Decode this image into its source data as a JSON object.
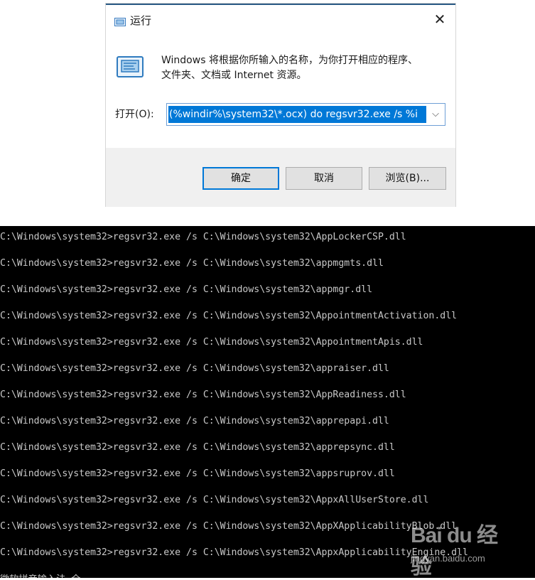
{
  "run_dialog": {
    "title": "运行",
    "close_symbol": "✕",
    "description_line1": "Windows 将根据你所输入的名称，为你打开相应的程序、",
    "description_line2": "文件夹、文档或 Internet 资源。",
    "open_label": "打开(O):",
    "command_value": "(%windir%\\system32\\*.ocx) do regsvr32.exe /s %i",
    "dropdown_symbol": "⌵",
    "buttons": {
      "ok": "确定",
      "cancel": "取消",
      "browse": "浏览(B)..."
    },
    "icons": [
      "run-small-icon",
      "run-large-icon",
      "close-icon",
      "chevron-down-icon"
    ]
  },
  "console": {
    "lines": [
      "C:\\Windows\\system32>regsvr32.exe /s C:\\Windows\\system32\\AppLockerCSP.dll",
      "C:\\Windows\\system32>regsvr32.exe /s C:\\Windows\\system32\\appmgmts.dll",
      "C:\\Windows\\system32>regsvr32.exe /s C:\\Windows\\system32\\appmgr.dll",
      "C:\\Windows\\system32>regsvr32.exe /s C:\\Windows\\system32\\AppointmentActivation.dll",
      "C:\\Windows\\system32>regsvr32.exe /s C:\\Windows\\system32\\AppointmentApis.dll",
      "C:\\Windows\\system32>regsvr32.exe /s C:\\Windows\\system32\\appraiser.dll",
      "C:\\Windows\\system32>regsvr32.exe /s C:\\Windows\\system32\\AppReadiness.dll",
      "C:\\Windows\\system32>regsvr32.exe /s C:\\Windows\\system32\\apprepapi.dll",
      "C:\\Windows\\system32>regsvr32.exe /s C:\\Windows\\system32\\apprepsync.dll",
      "C:\\Windows\\system32>regsvr32.exe /s C:\\Windows\\system32\\appsruprov.dll",
      "C:\\Windows\\system32>regsvr32.exe /s C:\\Windows\\system32\\AppxAllUserStore.dll",
      "C:\\Windows\\system32>regsvr32.exe /s C:\\Windows\\system32\\AppXApplicabilityBlob.dll",
      "C:\\Windows\\system32>regsvr32.exe /s C:\\Windows\\system32\\AppxApplicabilityEngine.dll",
      "微软拼音输入法 全"
    ]
  },
  "watermark": {
    "logo": "Bai du 经验",
    "url": "jingyan.baidu.com"
  },
  "colors": {
    "selection": "#0078d7",
    "console_bg": "#000000",
    "console_text": "#c8c8c8",
    "footer_bg": "#f0f0f0"
  }
}
